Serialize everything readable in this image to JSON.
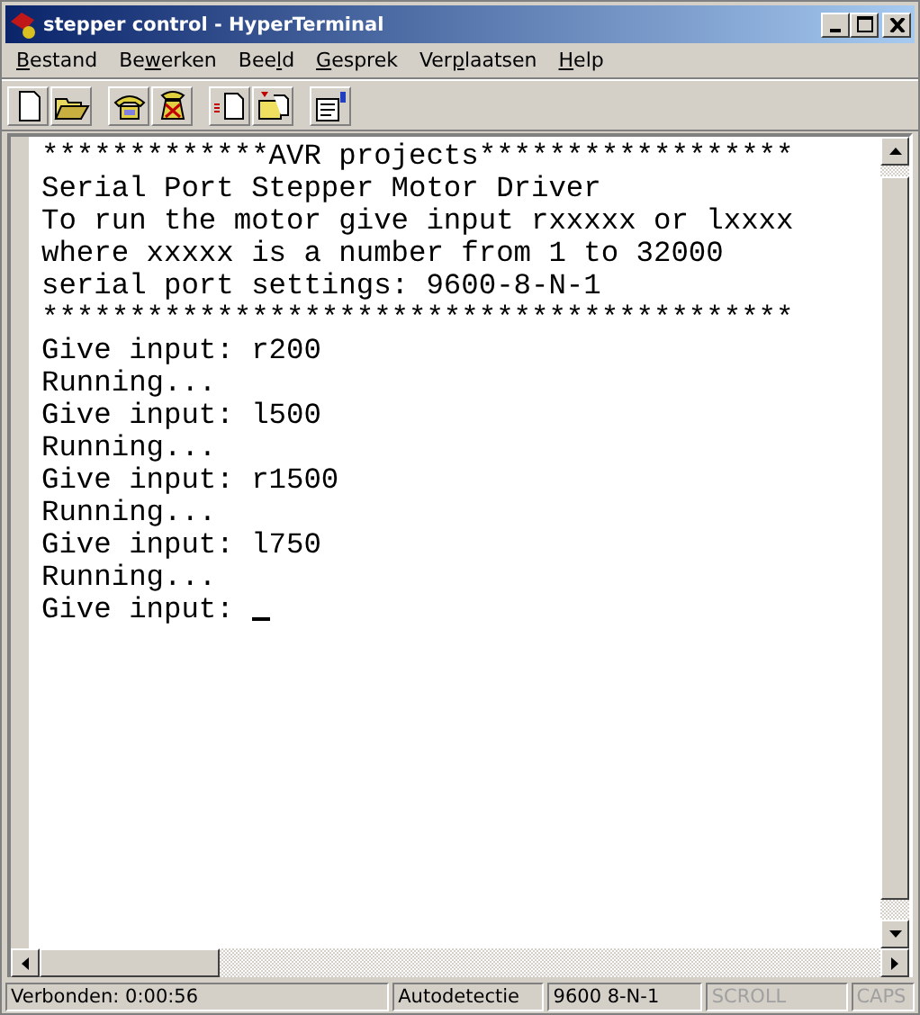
{
  "window": {
    "title": "stepper control - HyperTerminal"
  },
  "menu": [
    {
      "key": "B",
      "post": "estand"
    },
    {
      "pre": "Be",
      "key": "w",
      "post": "erken"
    },
    {
      "pre": "Bee",
      "key": "l",
      "post": "d"
    },
    {
      "key": "G",
      "post": "esprek"
    },
    {
      "pre": "Ver",
      "key": "p",
      "post": "laatsen"
    },
    {
      "key": "H",
      "post": "elp"
    }
  ],
  "terminal": {
    "lines": [
      "*************AVR projects******************",
      "Serial Port Stepper Motor Driver",
      "To run the motor give input rxxxxx or lxxxx",
      "where xxxxx is a number from 1 to 32000",
      "serial port settings: 9600-8-N-1",
      "*******************************************",
      "Give input: r200",
      "Running...",
      "Give input: l500",
      "Running...",
      "Give input: r1500",
      "Running...",
      "Give input: l750",
      "Running...",
      "Give input: "
    ]
  },
  "status_bar": [
    {
      "text": "Verbonden: 0:00:56",
      "disabled": false
    },
    {
      "text": "Autodetectie",
      "disabled": false
    },
    {
      "text": "9600 8-N-1",
      "disabled": false
    },
    {
      "text": "SCROLL",
      "disabled": true
    },
    {
      "text": "CAPS",
      "disabled": true
    }
  ]
}
